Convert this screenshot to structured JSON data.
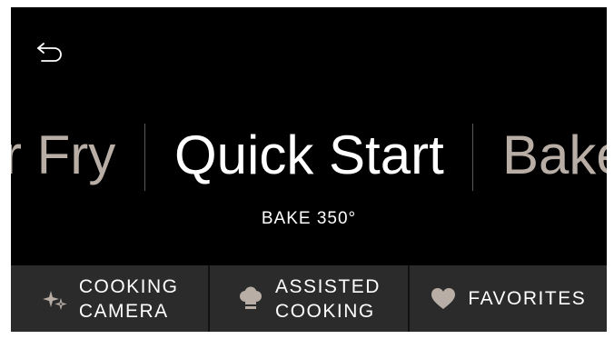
{
  "modes": {
    "prev": "r Fry",
    "current": "Quick Start",
    "next": "Bake"
  },
  "subtitle": "BAKE 350°",
  "tabs": [
    {
      "line1": "COOKING",
      "line2": "CAMERA",
      "icon": "sparkle-icon"
    },
    {
      "line1": "ASSISTED",
      "line2": "COOKING",
      "icon": "chef-hat-icon"
    },
    {
      "line1": "FAVORITES",
      "line2": "",
      "icon": "heart-icon"
    }
  ],
  "colors": {
    "background": "#000000",
    "tab_bar": "#2b2b2b",
    "icon_accent": "#b8aea6",
    "inactive_text": "#b8aea6"
  }
}
